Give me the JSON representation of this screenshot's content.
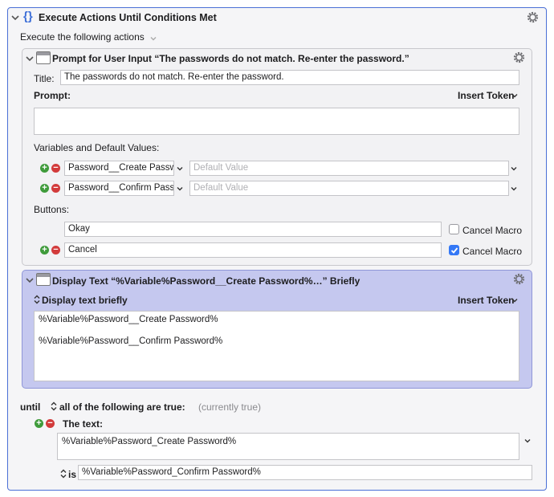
{
  "outer": {
    "title": "Execute Actions Until Conditions Met",
    "subtitle": "Execute the following actions"
  },
  "prompt_action": {
    "header": "Prompt for User Input “The passwords do not match. Re-enter the password.”",
    "title_label": "Title:",
    "title_value": "The passwords do not match. Re-enter the password.",
    "prompt_label": "Prompt:",
    "insert_token": "Insert Token",
    "variables_label": "Variables and Default Values:",
    "variables": [
      {
        "name": "Password__Create Passw",
        "default_placeholder": "Default Value"
      },
      {
        "name": "Password__Confirm Pass",
        "default_placeholder": "Default Value"
      }
    ],
    "buttons_label": "Buttons:",
    "buttons": [
      {
        "label": "Okay",
        "cancel_label": "Cancel Macro",
        "cancel_checked": false
      },
      {
        "label": "Cancel",
        "cancel_label": "Cancel Macro",
        "cancel_checked": true
      }
    ]
  },
  "display_action": {
    "header": "Display Text “%Variable%Password__Create Password%…” Briefly",
    "mode_label": "Display text briefly",
    "insert_token": "Insert Token",
    "lines": [
      "%Variable%Password__Create Password%",
      "%Variable%Password__Confirm Password%"
    ]
  },
  "until": {
    "label": "until",
    "condition_mode": "all of the following are true:",
    "status": "(currently true)",
    "text_label": "The text:",
    "text_value": "%Variable%Password_Create Password%",
    "operator": "is",
    "compare_value": "%Variable%Password_Confirm Password%"
  },
  "colors": {
    "accent": "#4a6fd6",
    "selected_bg": "#c5c8ef",
    "add_green": "#3f9b3b",
    "remove_red": "#d23b3b",
    "checkbox_blue": "#3478f6"
  }
}
